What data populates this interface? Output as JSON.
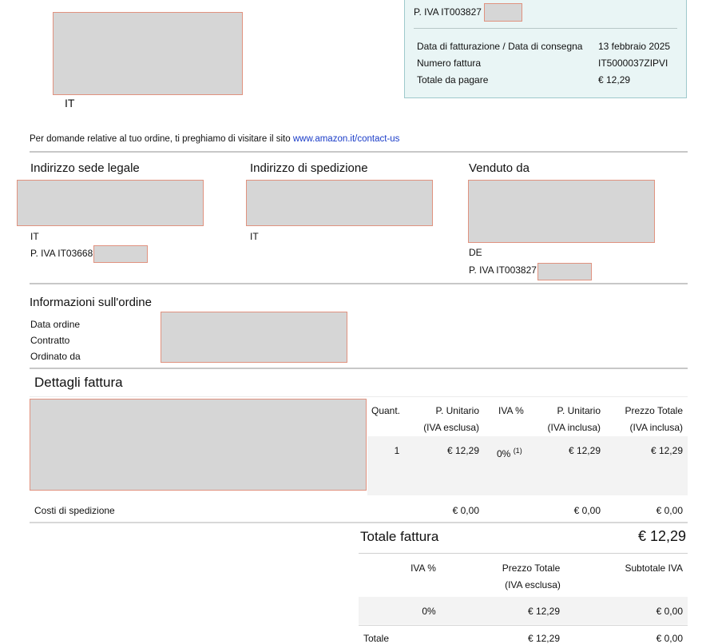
{
  "top": {
    "country": "IT",
    "vat_prefix": "P. IVA IT003827",
    "info_rows": [
      {
        "label": "Data di fatturazione / Data di consegna",
        "value": "13 febbraio 2025"
      },
      {
        "label": "Numero fattura",
        "value": "IT5000037ZIPVI"
      },
      {
        "label": "Totale da pagare",
        "value": "€ 12,29"
      }
    ]
  },
  "contact": {
    "text": "Per domande relative al tuo ordine, ti preghiamo di visitare il sito",
    "link": "www.amazon.it/contact-us"
  },
  "addresses": {
    "legal": {
      "heading": "Indirizzo sede legale",
      "country": "IT",
      "vat": "P. IVA IT03668"
    },
    "shipping": {
      "heading": "Indirizzo di spedizione",
      "country": "IT"
    },
    "seller": {
      "heading": "Venduto da",
      "country": "DE",
      "vat": "P. IVA IT003827"
    }
  },
  "order_info": {
    "heading": "Informazioni sull'ordine",
    "labels": [
      "Data ordine",
      "Contratto",
      "Ordinato da"
    ]
  },
  "invoice": {
    "heading": "Dettagli fattura",
    "columns": [
      {
        "line1": "Quant.",
        "line2": ""
      },
      {
        "line1": "P. Unitario",
        "line2": "(IVA esclusa)"
      },
      {
        "line1": "IVA %",
        "line2": ""
      },
      {
        "line1": "P. Unitario",
        "line2": "(IVA inclusa)"
      },
      {
        "line1": "Prezzo Totale",
        "line2": "(IVA inclusa)"
      }
    ],
    "item": {
      "qty": "1",
      "unit_excl": "€ 12,29",
      "vat": "0%",
      "vat_note": "(1)",
      "unit_incl": "€ 12,29",
      "total_incl": "€ 12,29"
    },
    "shipping": {
      "label": "Costi di spedizione",
      "unit_excl": "€ 0,00",
      "unit_incl": "€ 0,00",
      "total_incl": "€ 0,00"
    },
    "total": {
      "label": "Totale fattura",
      "value": "€ 12,29"
    }
  },
  "vat_summary": {
    "columns": [
      {
        "line1": "IVA %",
        "line2": ""
      },
      {
        "line1": "Prezzo Totale",
        "line2": "(IVA esclusa)"
      },
      {
        "line1": "Subtotale IVA",
        "line2": ""
      }
    ],
    "row": {
      "vat": "0%",
      "total_excl": "€ 12,29",
      "vat_sub": "€ 0,00"
    },
    "total_row": {
      "label": "Totale",
      "total_excl": "€ 12,29",
      "vat_sub": "€ 0,00"
    }
  }
}
